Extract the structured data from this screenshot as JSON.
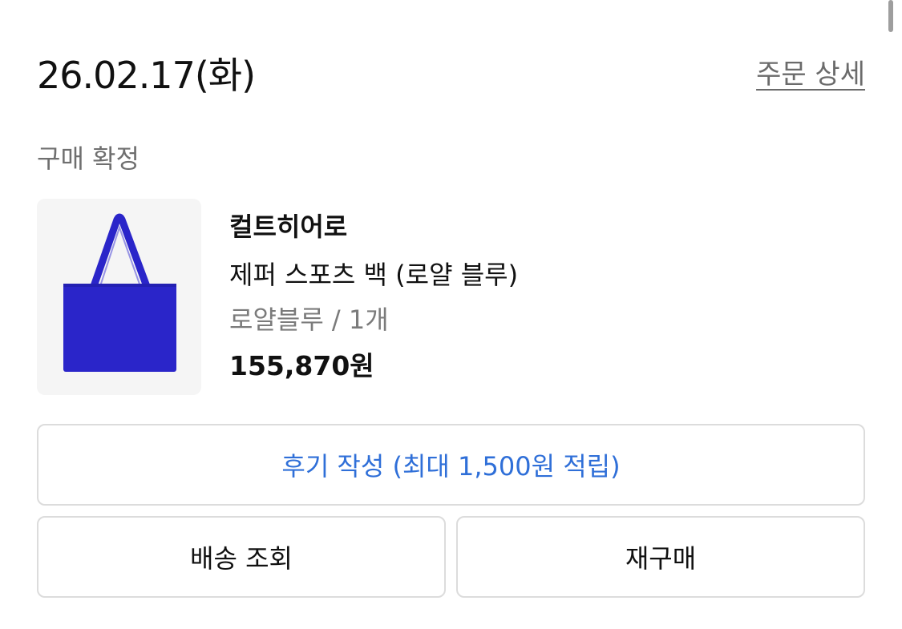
{
  "order": {
    "date": "26.02.17(화)",
    "detail_link": "주문 상세",
    "status": "구매 확정"
  },
  "product": {
    "brand": "컬트히어로",
    "name": "제퍼 스포츠 백 (로얄 블루)",
    "option": "로얄블루 / 1개",
    "price": "155,870원",
    "image_icon": "tote-bag-image",
    "image_color": "#2a25c9"
  },
  "actions": {
    "review_label": "후기 작성 (최대 1,500원 적립)",
    "delivery_label": "배송 조회",
    "rebuy_label": "재구매"
  },
  "colors": {
    "accent": "#2f6fd8"
  }
}
